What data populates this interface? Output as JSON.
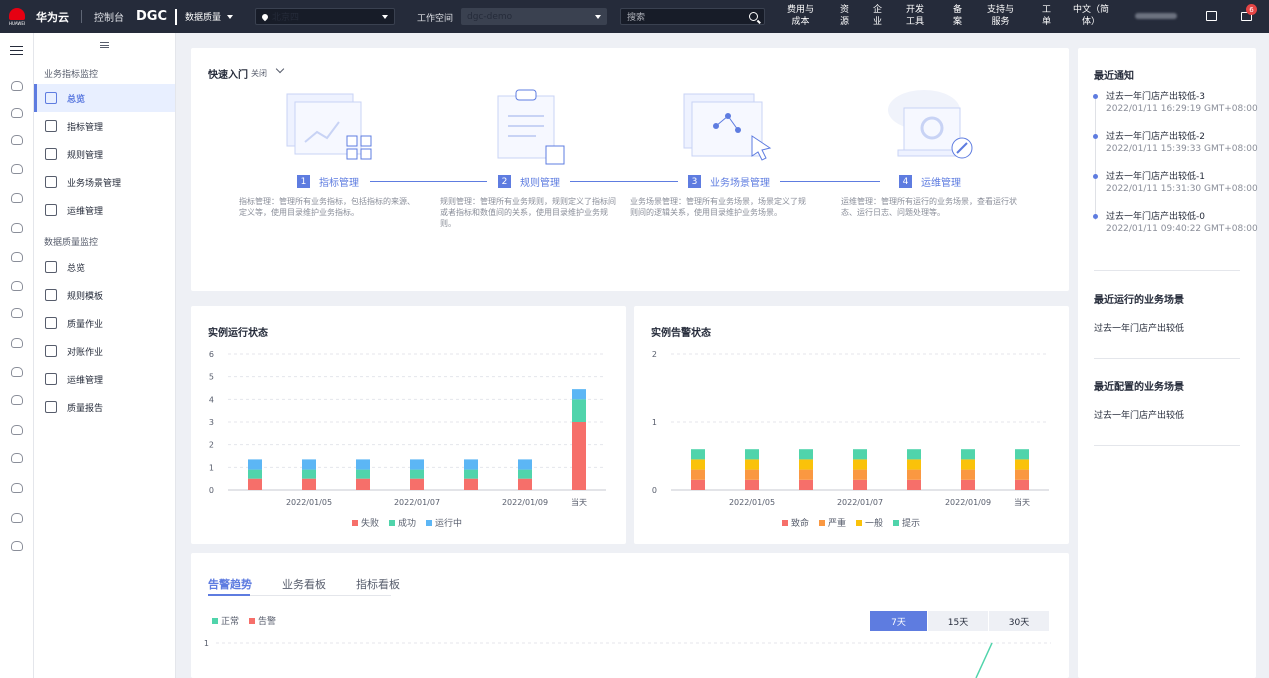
{
  "topbar": {
    "logo_text": "HUAWEI",
    "brand": "华为云",
    "console": "控制台",
    "service": "DGC",
    "module": "数据质量",
    "region": "北京四",
    "workspace_label": "工作空间",
    "workspace": "dgc-demo",
    "search_placeholder": "搜索",
    "nav": [
      {
        "label": "费用与\n成本"
      },
      {
        "label": "资\n源"
      },
      {
        "label": "企\n业"
      },
      {
        "label": "开发\n工具"
      },
      {
        "label": "备\n案"
      },
      {
        "label": "支持与\n服务"
      },
      {
        "label": "工\n单"
      },
      {
        "label": "中文（简\n体）"
      }
    ],
    "mail_badge": "6"
  },
  "sidebar": {
    "group1": "业务指标监控",
    "group1_items": [
      "总览",
      "指标管理",
      "规则管理",
      "业务场景管理",
      "运维管理"
    ],
    "group2": "数据质量监控",
    "group2_items": [
      "总览",
      "规则模板",
      "质量作业",
      "对账作业",
      "运维管理",
      "质量报告"
    ]
  },
  "quick": {
    "title": "快速入门",
    "toggle": "关闭",
    "steps": [
      {
        "num": "1",
        "label": "指标管理",
        "desc": "指标管理：管理所有业务指标，包括指标的来源、定义等，使用目录维护业务指标。"
      },
      {
        "num": "2",
        "label": "规则管理",
        "desc": "规则管理：管理所有业务规则，规则定义了指标间或者指标和数值间的关系，使用目录维护业务规则。"
      },
      {
        "num": "3",
        "label": "业务场景管理",
        "desc": "业务场景管理：管理所有业务场景，场景定义了规则间的逻辑关系，使用目录维护业务场景。"
      },
      {
        "num": "4",
        "label": "运维管理",
        "desc": "运维管理：管理所有运行的业务场景，查看运行状态、运行日志、问题处理等。"
      }
    ]
  },
  "chart_data": [
    {
      "type": "bar",
      "title": "实例运行状态",
      "stacked": true,
      "categories": [
        "2022/01/04",
        "2022/01/05",
        "2022/01/06",
        "2022/01/07",
        "2022/01/08",
        "2022/01/09",
        "当天"
      ],
      "x_tick_labels": [
        "2022/01/05",
        "2022/01/07",
        "2022/01/09",
        "当天"
      ],
      "ylim": [
        0,
        6
      ],
      "yticks": [
        0,
        1,
        2,
        3,
        4,
        5,
        6
      ],
      "series": [
        {
          "name": "失败",
          "color": "#f66f6a",
          "values": [
            0.5,
            0.5,
            0.5,
            0.5,
            0.5,
            0.5,
            3
          ]
        },
        {
          "name": "成功",
          "color": "#50d4ab",
          "values": [
            0.4,
            0.4,
            0.4,
            0.4,
            0.4,
            0.4,
            1
          ]
        },
        {
          "name": "运行中",
          "color": "#5cb6f5",
          "values": [
            0.45,
            0.45,
            0.45,
            0.45,
            0.45,
            0.45,
            0.45
          ]
        }
      ],
      "legend": "bottom"
    },
    {
      "type": "bar",
      "title": "实例告警状态",
      "stacked": true,
      "categories": [
        "2022/01/04",
        "2022/01/05",
        "2022/01/06",
        "2022/01/07",
        "2022/01/08",
        "2022/01/09",
        "当天"
      ],
      "x_tick_labels": [
        "2022/01/05",
        "2022/01/07",
        "2022/01/09",
        "当天"
      ],
      "ylim": [
        0,
        2
      ],
      "yticks": [
        0,
        1,
        2
      ],
      "series": [
        {
          "name": "致命",
          "color": "#f66f6a",
          "values": [
            0.15,
            0.15,
            0.15,
            0.15,
            0.15,
            0.15,
            0.15
          ]
        },
        {
          "name": "严重",
          "color": "#fa9841",
          "values": [
            0.15,
            0.15,
            0.15,
            0.15,
            0.15,
            0.15,
            0.15
          ]
        },
        {
          "name": "一般",
          "color": "#fac20a",
          "values": [
            0.15,
            0.15,
            0.15,
            0.15,
            0.15,
            0.15,
            0.15
          ]
        },
        {
          "name": "提示",
          "color": "#50d4ab",
          "values": [
            0.15,
            0.15,
            0.15,
            0.15,
            0.15,
            0.15,
            0.15
          ]
        }
      ],
      "legend": "bottom"
    },
    {
      "type": "line",
      "ylim": [
        0,
        1
      ],
      "yticks": [
        1
      ],
      "series": [
        {
          "name": "正常",
          "color": "#50d4ab"
        },
        {
          "name": "告警",
          "color": "#f66f6a"
        }
      ],
      "legend": "top-left"
    }
  ],
  "trend": {
    "tabs": [
      "告警趋势",
      "业务看板",
      "指标看板"
    ],
    "ranges": [
      "7天",
      "15天",
      "30天"
    ],
    "legend": [
      "正常",
      "告警"
    ]
  },
  "right": {
    "notice_title": "最近通知",
    "notices": [
      {
        "title": "过去一年门店产出较低-3",
        "time": "2022/01/11 16:29:19 GMT+08:00"
      },
      {
        "title": "过去一年门店产出较低-2",
        "time": "2022/01/11 15:39:33 GMT+08:00"
      },
      {
        "title": "过去一年门店产出较低-1",
        "time": "2022/01/11 15:31:30 GMT+08:00"
      },
      {
        "title": "过去一年门店产出较低-0",
        "time": "2022/01/11 09:40:22 GMT+08:00"
      }
    ],
    "recent_run_title": "最近运行的业务场景",
    "recent_run": "过去一年门店产出较低",
    "recent_config_title": "最近配置的业务场景",
    "recent_config": "过去一年门店产出较低"
  }
}
